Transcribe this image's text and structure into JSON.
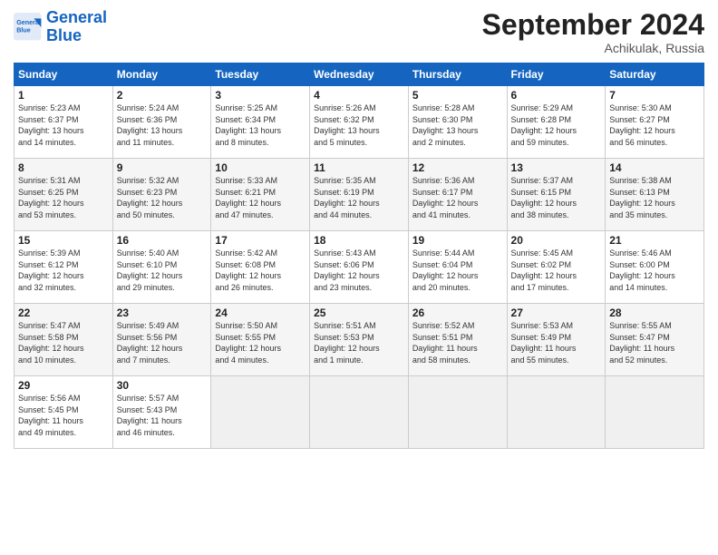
{
  "logo": {
    "line1": "General",
    "line2": "Blue"
  },
  "title": "September 2024",
  "subtitle": "Achikulak, Russia",
  "days_of_week": [
    "Sunday",
    "Monday",
    "Tuesday",
    "Wednesday",
    "Thursday",
    "Friday",
    "Saturday"
  ],
  "weeks": [
    [
      {
        "day": "1",
        "lines": [
          "Sunrise: 5:23 AM",
          "Sunset: 6:37 PM",
          "Daylight: 13 hours",
          "and 14 minutes."
        ]
      },
      {
        "day": "2",
        "lines": [
          "Sunrise: 5:24 AM",
          "Sunset: 6:36 PM",
          "Daylight: 13 hours",
          "and 11 minutes."
        ]
      },
      {
        "day": "3",
        "lines": [
          "Sunrise: 5:25 AM",
          "Sunset: 6:34 PM",
          "Daylight: 13 hours",
          "and 8 minutes."
        ]
      },
      {
        "day": "4",
        "lines": [
          "Sunrise: 5:26 AM",
          "Sunset: 6:32 PM",
          "Daylight: 13 hours",
          "and 5 minutes."
        ]
      },
      {
        "day": "5",
        "lines": [
          "Sunrise: 5:28 AM",
          "Sunset: 6:30 PM",
          "Daylight: 13 hours",
          "and 2 minutes."
        ]
      },
      {
        "day": "6",
        "lines": [
          "Sunrise: 5:29 AM",
          "Sunset: 6:28 PM",
          "Daylight: 12 hours",
          "and 59 minutes."
        ]
      },
      {
        "day": "7",
        "lines": [
          "Sunrise: 5:30 AM",
          "Sunset: 6:27 PM",
          "Daylight: 12 hours",
          "and 56 minutes."
        ]
      }
    ],
    [
      {
        "day": "8",
        "lines": [
          "Sunrise: 5:31 AM",
          "Sunset: 6:25 PM",
          "Daylight: 12 hours",
          "and 53 minutes."
        ]
      },
      {
        "day": "9",
        "lines": [
          "Sunrise: 5:32 AM",
          "Sunset: 6:23 PM",
          "Daylight: 12 hours",
          "and 50 minutes."
        ]
      },
      {
        "day": "10",
        "lines": [
          "Sunrise: 5:33 AM",
          "Sunset: 6:21 PM",
          "Daylight: 12 hours",
          "and 47 minutes."
        ]
      },
      {
        "day": "11",
        "lines": [
          "Sunrise: 5:35 AM",
          "Sunset: 6:19 PM",
          "Daylight: 12 hours",
          "and 44 minutes."
        ]
      },
      {
        "day": "12",
        "lines": [
          "Sunrise: 5:36 AM",
          "Sunset: 6:17 PM",
          "Daylight: 12 hours",
          "and 41 minutes."
        ]
      },
      {
        "day": "13",
        "lines": [
          "Sunrise: 5:37 AM",
          "Sunset: 6:15 PM",
          "Daylight: 12 hours",
          "and 38 minutes."
        ]
      },
      {
        "day": "14",
        "lines": [
          "Sunrise: 5:38 AM",
          "Sunset: 6:13 PM",
          "Daylight: 12 hours",
          "and 35 minutes."
        ]
      }
    ],
    [
      {
        "day": "15",
        "lines": [
          "Sunrise: 5:39 AM",
          "Sunset: 6:12 PM",
          "Daylight: 12 hours",
          "and 32 minutes."
        ]
      },
      {
        "day": "16",
        "lines": [
          "Sunrise: 5:40 AM",
          "Sunset: 6:10 PM",
          "Daylight: 12 hours",
          "and 29 minutes."
        ]
      },
      {
        "day": "17",
        "lines": [
          "Sunrise: 5:42 AM",
          "Sunset: 6:08 PM",
          "Daylight: 12 hours",
          "and 26 minutes."
        ]
      },
      {
        "day": "18",
        "lines": [
          "Sunrise: 5:43 AM",
          "Sunset: 6:06 PM",
          "Daylight: 12 hours",
          "and 23 minutes."
        ]
      },
      {
        "day": "19",
        "lines": [
          "Sunrise: 5:44 AM",
          "Sunset: 6:04 PM",
          "Daylight: 12 hours",
          "and 20 minutes."
        ]
      },
      {
        "day": "20",
        "lines": [
          "Sunrise: 5:45 AM",
          "Sunset: 6:02 PM",
          "Daylight: 12 hours",
          "and 17 minutes."
        ]
      },
      {
        "day": "21",
        "lines": [
          "Sunrise: 5:46 AM",
          "Sunset: 6:00 PM",
          "Daylight: 12 hours",
          "and 14 minutes."
        ]
      }
    ],
    [
      {
        "day": "22",
        "lines": [
          "Sunrise: 5:47 AM",
          "Sunset: 5:58 PM",
          "Daylight: 12 hours",
          "and 10 minutes."
        ]
      },
      {
        "day": "23",
        "lines": [
          "Sunrise: 5:49 AM",
          "Sunset: 5:56 PM",
          "Daylight: 12 hours",
          "and 7 minutes."
        ]
      },
      {
        "day": "24",
        "lines": [
          "Sunrise: 5:50 AM",
          "Sunset: 5:55 PM",
          "Daylight: 12 hours",
          "and 4 minutes."
        ]
      },
      {
        "day": "25",
        "lines": [
          "Sunrise: 5:51 AM",
          "Sunset: 5:53 PM",
          "Daylight: 12 hours",
          "and 1 minute."
        ]
      },
      {
        "day": "26",
        "lines": [
          "Sunrise: 5:52 AM",
          "Sunset: 5:51 PM",
          "Daylight: 11 hours",
          "and 58 minutes."
        ]
      },
      {
        "day": "27",
        "lines": [
          "Sunrise: 5:53 AM",
          "Sunset: 5:49 PM",
          "Daylight: 11 hours",
          "and 55 minutes."
        ]
      },
      {
        "day": "28",
        "lines": [
          "Sunrise: 5:55 AM",
          "Sunset: 5:47 PM",
          "Daylight: 11 hours",
          "and 52 minutes."
        ]
      }
    ],
    [
      {
        "day": "29",
        "lines": [
          "Sunrise: 5:56 AM",
          "Sunset: 5:45 PM",
          "Daylight: 11 hours",
          "and 49 minutes."
        ]
      },
      {
        "day": "30",
        "lines": [
          "Sunrise: 5:57 AM",
          "Sunset: 5:43 PM",
          "Daylight: 11 hours",
          "and 46 minutes."
        ]
      },
      {
        "day": "",
        "lines": []
      },
      {
        "day": "",
        "lines": []
      },
      {
        "day": "",
        "lines": []
      },
      {
        "day": "",
        "lines": []
      },
      {
        "day": "",
        "lines": []
      }
    ]
  ]
}
